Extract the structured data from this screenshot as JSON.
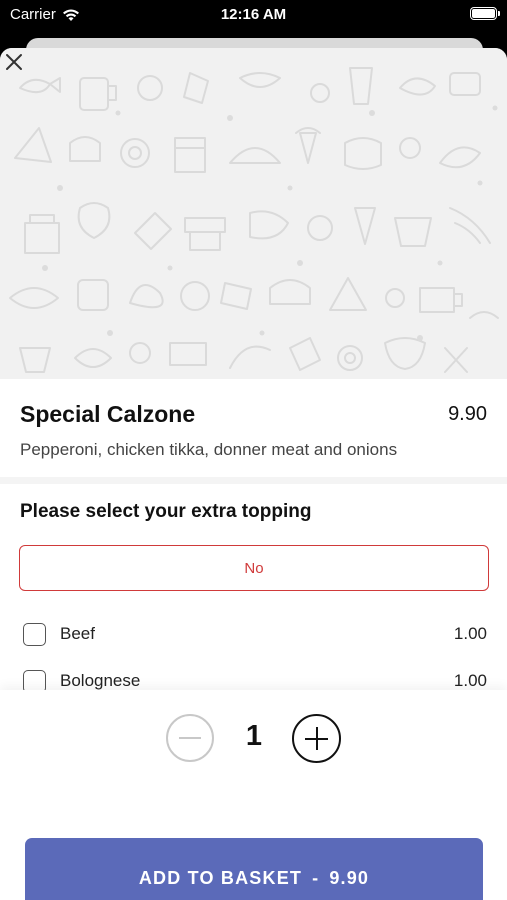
{
  "status_bar": {
    "carrier": "Carrier",
    "time": "12:16 AM"
  },
  "product": {
    "name": "Special Calzone",
    "price": "9.90",
    "description": "Pepperoni, chicken tikka, donner meat and onions"
  },
  "options": {
    "title": "Please select your extra topping",
    "no_label": "No",
    "items": [
      {
        "label": "Beef",
        "price": "1.00"
      },
      {
        "label": "Bolognese",
        "price": "1.00"
      }
    ]
  },
  "quantity": {
    "value": "1"
  },
  "add_button": {
    "label": "ADD TO BASKET",
    "separator": "-",
    "price": "9.90"
  },
  "colors": {
    "accent": "#5b6ab9",
    "danger": "#d03a3a",
    "hero_bg": "#f1f1f1"
  },
  "icons": [
    "wifi-icon",
    "battery-icon",
    "close-icon",
    "minus-icon",
    "plus-icon",
    "checkbox-icon",
    "food-pattern"
  ]
}
